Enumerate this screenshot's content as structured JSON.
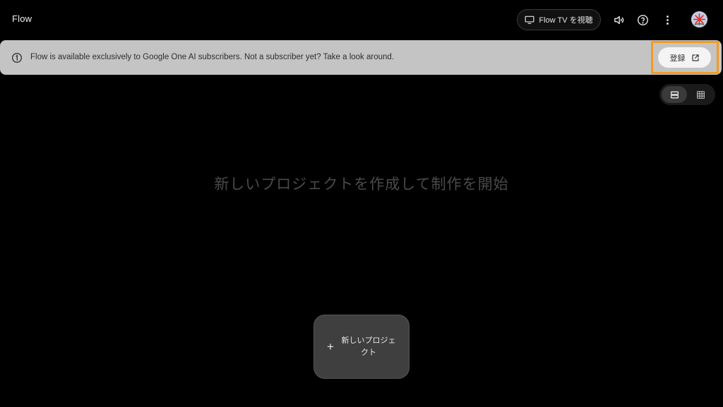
{
  "app": {
    "title": "Flow"
  },
  "header": {
    "tv_button_label": "Flow TV を視聴",
    "icons": [
      "tv-icon",
      "volume-icon",
      "help-icon",
      "more-vert-icon"
    ]
  },
  "banner": {
    "message": "Flow is available exclusively to Google One AI subscribers. Not a subscriber yet? Take a look around.",
    "register_label": "登録",
    "highlight_color": "#f39a21"
  },
  "view_toggle": {
    "active": "list"
  },
  "empty_state": {
    "message": "新しいプロジェクトを作成して制作を開始"
  },
  "new_project": {
    "label": "新しいプロジェクト"
  },
  "colors": {
    "background": "#000000",
    "banner": "#c4c4c4",
    "card": "#3f3f3f",
    "accent": "#f39a21"
  }
}
